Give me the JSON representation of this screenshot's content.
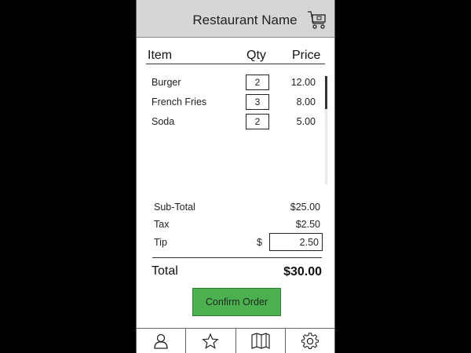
{
  "header": {
    "title": "Restaurant Name",
    "cart_icon": "shopping-cart-icon"
  },
  "columns": {
    "item": "Item",
    "qty": "Qty",
    "price": "Price"
  },
  "items": [
    {
      "name": "Burger",
      "qty": "2",
      "price": "12.00"
    },
    {
      "name": "French Fries",
      "qty": "3",
      "price": "8.00"
    },
    {
      "name": "Soda",
      "qty": "2",
      "price": "5.00"
    }
  ],
  "summary": {
    "subtotal_label": "Sub-Total",
    "subtotal_value": "$25.00",
    "tax_label": "Tax",
    "tax_value": "$2.50",
    "tip_label": "Tip",
    "tip_currency": "$",
    "tip_value": "2.50",
    "total_label": "Total",
    "total_value": "$30.00"
  },
  "confirm_label": "Confirm Order",
  "tabbar": [
    {
      "icon": "person-icon"
    },
    {
      "icon": "star-icon"
    },
    {
      "icon": "map-icon"
    },
    {
      "icon": "gear-icon"
    }
  ],
  "colors": {
    "header_bg": "#d6d6d6",
    "confirm_bg": "#4cb050"
  }
}
